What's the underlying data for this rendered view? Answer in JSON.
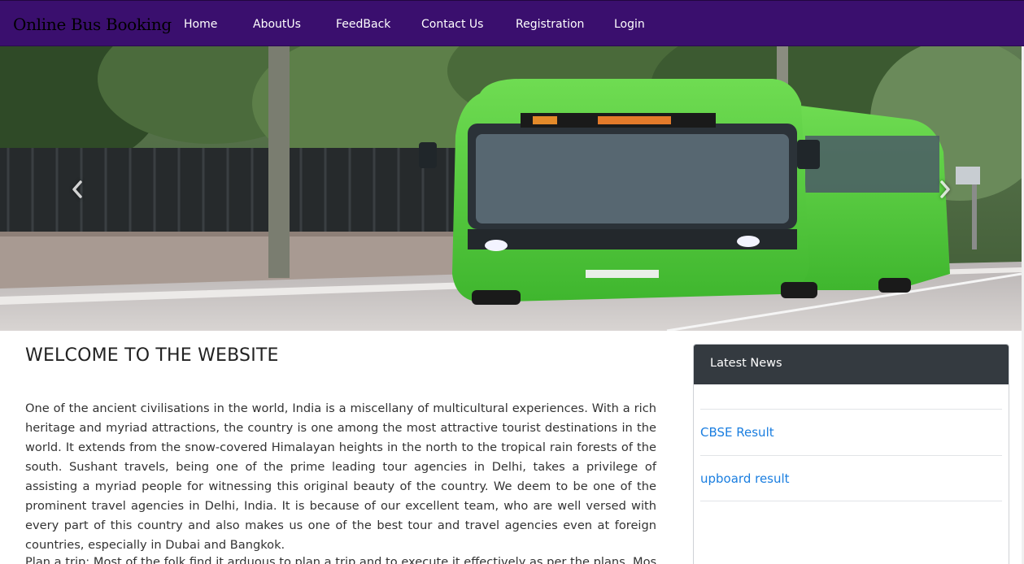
{
  "navbar": {
    "brand": "Online Bus Booking",
    "items": [
      {
        "label": "Home"
      },
      {
        "label": "AboutUs"
      },
      {
        "label": "FeedBack"
      },
      {
        "label": "Contact Us"
      },
      {
        "label": "Registration"
      },
      {
        "label": "Login"
      }
    ],
    "background_color": "#3a0f6e"
  },
  "carousel": {
    "prev_icon": "chevron-left-icon",
    "next_icon": "chevron-right-icon",
    "image_subject": "green articulated city bus on a tree-lined road"
  },
  "main": {
    "title": "WELCOME TO THE WEBSITE",
    "paragraph_1": "One of the ancient civilisations in the world, India is a miscellany of multicultural experiences. With a rich heritage and myriad attractions, the country is one among the most attractive tourist destinations in the world. It extends from the snow-covered Himalayan heights in the north to the tropical rain forests of the south. Sushant travels, being one of the prime leading tour agencies in Delhi, takes a privilege of assisting a myriad people for witnessing this original beauty of the country. We deem to be one of the prominent travel agencies in Delhi, India. It is because of our excellent team, who are well versed with every part of this country and also makes us one of the best tour and travel agencies even at foreign countries, especially in Dubai and Bangkok.",
    "paragraph_2": "Plan a trip: Most of the folk find it arduous to plan a trip and to execute it effectively as per the plans. Most of"
  },
  "news": {
    "header": "Latest News",
    "items": [
      {
        "label": "CBSE Result"
      },
      {
        "label": "upboard result"
      }
    ],
    "link_color": "#1a7ee0",
    "header_color": "#343a40"
  }
}
